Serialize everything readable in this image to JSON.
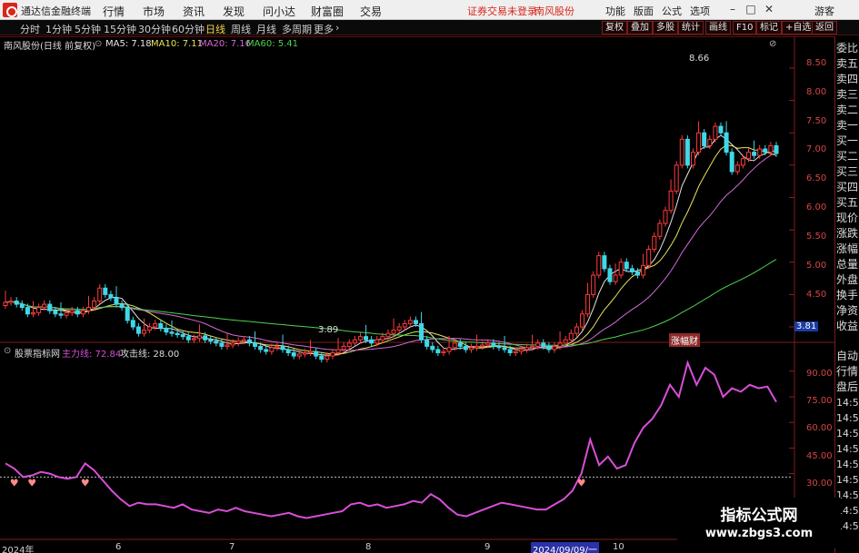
{
  "titlebar": {
    "app_title": "通达信金融终端",
    "menus": [
      "行情",
      "市场",
      "资讯",
      "发现",
      "问小达",
      "财富圈",
      "交易"
    ],
    "notice": "证券交易未登录",
    "stock": "南风股份",
    "buttons": [
      "功能",
      "版面",
      "公式",
      "选项"
    ],
    "guest": "游客",
    "win_min": "–",
    "win_max": "□",
    "win_close": "✕"
  },
  "toolbar": {
    "periods": [
      "分时",
      "1分钟",
      "5分钟",
      "15分钟",
      "30分钟",
      "60分钟",
      "日线",
      "周线",
      "月线",
      "多周期",
      "更多"
    ],
    "selected": "日线",
    "right_buttons": [
      "复权",
      "叠加",
      "多股",
      "统计",
      "画线",
      "F10",
      "标记",
      "+自选",
      "返回"
    ]
  },
  "main_chart": {
    "header": "南风股份(日线 前复权)",
    "ma": [
      {
        "label": "MA5: 7.18",
        "color": "#e6e6e6"
      },
      {
        "label": "MA10: 7.11",
        "color": "#e8e35a"
      },
      {
        "label": "MA20: 7.16",
        "color": "#d66ad6"
      },
      {
        "label": "MA60: 5.41",
        "color": "#4fd24f"
      }
    ],
    "y_ticks": [
      "8.50",
      "8.00",
      "7.50",
      "7.00",
      "6.50",
      "6.00",
      "5.50",
      "5.00",
      "4.50"
    ],
    "high_label": "8.66",
    "low_label": "3.89",
    "cursor_price": "3.81",
    "tag": "涨幅财"
  },
  "indicator": {
    "header": "股票指标网",
    "line1": "主力线: 72.84",
    "line2": "攻击线: 28.00",
    "y_ticks": [
      "90.00",
      "75.00",
      "60.00",
      "45.00",
      "30.00"
    ]
  },
  "date_axis": {
    "labels": [
      "2024年",
      "6",
      "7",
      "8",
      "9",
      "10"
    ],
    "current": "2024/09/09/一"
  },
  "sidebar": {
    "items": [
      "委比",
      "卖五",
      "卖四",
      "卖三",
      "卖二",
      "卖一",
      "买一",
      "买二",
      "买三",
      "买四",
      "买五",
      "现价",
      "涨跌",
      "涨幅",
      "总量",
      "外盘",
      "换手",
      "净资",
      "收益",
      "自动",
      "行情",
      "盘后"
    ],
    "times": [
      "14:5",
      "14:5",
      "14:5",
      "14:5",
      "14:5",
      "14:5",
      "14:5",
      "14:5",
      "14:5"
    ]
  },
  "watermark": {
    "line1": "指标公式网",
    "line2": "www.zbgs3.com"
  },
  "chart_data": [
    {
      "type": "candlestick",
      "title": "南风股份(日线 前复权)",
      "ylim": [
        3.7,
        8.8
      ],
      "y_ticks": [
        4.5,
        5.0,
        5.5,
        6.0,
        6.5,
        7.0,
        7.5,
        8.0,
        8.5
      ],
      "x_labels": [
        "2024年",
        "6",
        "7",
        "8",
        "9",
        "10"
      ],
      "annotations": [
        {
          "text": "8.66",
          "value": 8.66
        },
        {
          "text": "3.89",
          "value": 3.89
        }
      ],
      "series_close": [
        4.88,
        4.9,
        4.85,
        4.8,
        4.7,
        4.72,
        4.8,
        4.85,
        4.75,
        4.7,
        4.68,
        4.72,
        4.75,
        4.7,
        4.75,
        4.8,
        4.9,
        5.1,
        5.0,
        4.95,
        4.85,
        4.8,
        4.6,
        4.5,
        4.4,
        4.45,
        4.5,
        4.55,
        4.48,
        4.42,
        4.4,
        4.38,
        4.35,
        4.3,
        4.32,
        4.36,
        4.3,
        4.28,
        4.25,
        4.2,
        4.22,
        4.25,
        4.28,
        4.3,
        4.25,
        4.2,
        4.15,
        4.12,
        4.18,
        4.2,
        4.15,
        4.1,
        4.05,
        4.08,
        4.1,
        4.12,
        4.05,
        4.0,
        4.05,
        4.1,
        4.15,
        4.2,
        4.25,
        4.3,
        4.35,
        4.3,
        4.25,
        4.3,
        4.35,
        4.4,
        4.45,
        4.5,
        4.55,
        4.6,
        4.55,
        4.3,
        4.2,
        4.15,
        4.1,
        4.12,
        4.18,
        4.25,
        4.2,
        4.15,
        4.18,
        4.2,
        4.22,
        4.25,
        4.2,
        4.18,
        4.15,
        4.1,
        4.12,
        4.15,
        4.18,
        4.2,
        4.25,
        4.2,
        4.15,
        4.2,
        4.25,
        4.3,
        4.4,
        4.5,
        4.7,
        5.0,
        5.3,
        5.6,
        5.4,
        5.2,
        5.3,
        5.5,
        5.4,
        5.35,
        5.3,
        5.45,
        5.7,
        5.9,
        6.1,
        6.3,
        6.6,
        7.0,
        7.4,
        7.0,
        7.2,
        7.5,
        7.3,
        7.4,
        7.6,
        7.5,
        7.2,
        6.9,
        7.0,
        7.1,
        7.2,
        7.15,
        7.25,
        7.2,
        7.3,
        7.18
      ]
    },
    {
      "type": "line",
      "title": "股票指标网",
      "ylim": [
        0,
        100
      ],
      "y_ticks": [
        30,
        45,
        60,
        75,
        90
      ],
      "series": [
        {
          "name": "主力线",
          "values": [
            36,
            33,
            28,
            29,
            31,
            30,
            28,
            27,
            28,
            36,
            32,
            26,
            20,
            15,
            11,
            13,
            12,
            12,
            11,
            10,
            12,
            9,
            8,
            7,
            9,
            8,
            10,
            8,
            7,
            6,
            5,
            6,
            7,
            5,
            4,
            5,
            6,
            7,
            8,
            12,
            13,
            11,
            12,
            10,
            11,
            12,
            14,
            13,
            18,
            15,
            10,
            6,
            5,
            7,
            9,
            11,
            13,
            12,
            11,
            10,
            9,
            9,
            12,
            15,
            20,
            30,
            50,
            35,
            40,
            33,
            35,
            48,
            57,
            62,
            70,
            82,
            75,
            95,
            82,
            92,
            88,
            75,
            80,
            78,
            82,
            80,
            81,
            72
          ]
        },
        {
          "name": "攻击线",
          "values": [
            28
          ]
        }
      ]
    }
  ]
}
